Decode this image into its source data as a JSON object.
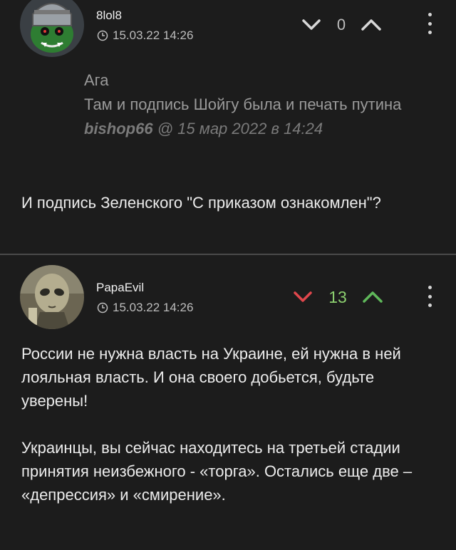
{
  "comments": [
    {
      "username": "8lol8",
      "date": "15.03.22 14:26",
      "score": "0",
      "quote": {
        "lines": [
          "Ага",
          "Там и подпись Шойгу была и печать путина"
        ],
        "author": "bishop66",
        "at": "@ 15 мар 2022 в 14:24"
      },
      "paragraphs": [
        "И подпись Зеленского \"С приказом ознакомлен\"?"
      ],
      "avatar_icon": "knight-helmet-avatar",
      "arrow_color": "#d8d8d8"
    },
    {
      "username": "PapaEvil",
      "date": "15.03.22 14:26",
      "score": "13",
      "paragraphs": [
        "России не нужна власть на Украине, ей нужна в ней лояльная власть. И она своего добьется, будьте уверены!",
        "Украинцы, вы сейчас находитесь на третьей стадии принятия неизбежного - «торга». Остались еще две – «депрессия» и «смирение»."
      ],
      "avatar_icon": "alien-avatar",
      "downvote_color": "#e0474c",
      "upvote_color": "#5fb85a",
      "score_color": "#8ccf6f"
    }
  ]
}
